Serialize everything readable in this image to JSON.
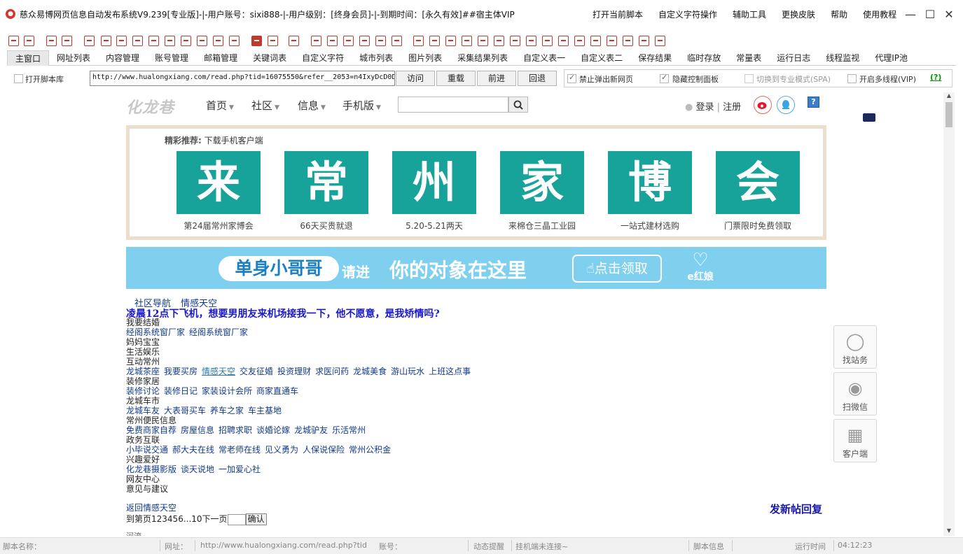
{
  "window": {
    "title": "慈众易博网页信息自动发布系统V9.239[专业版]-|-用户账号：sixi888-|-用户级别：[终身会员]-|-到期时间：[永久有效]##宿主体VIP",
    "menu": [
      "打开当前脚本",
      "自定义字符操作",
      "辅助工具",
      "更换皮肤",
      "帮助",
      "使用教程"
    ]
  },
  "tabs": [
    "主窗口",
    "网址列表",
    "内容管理",
    "账号管理",
    "邮箱管理",
    "关键词表",
    "自定义字符",
    "城市列表",
    "图片列表",
    "采集结果列表",
    "自定义表一",
    "自定义表二",
    "保存结果",
    "临时存放",
    "常量表",
    "运行日志",
    "线程监视",
    "代理IP池"
  ],
  "address_bar": {
    "open_library_label": "打开脚本库",
    "url": "http://www.hualongxiang.com/read.php?tid=16075550&refer__2053=n4IxyDcD0D",
    "buttons": [
      "访问",
      "重载",
      "前进",
      "回退"
    ],
    "options": [
      {
        "label": "禁止弹出新网页",
        "checked": true,
        "disabled": false
      },
      {
        "label": "隐藏控制面板",
        "checked": true,
        "disabled": false
      },
      {
        "label": "切换到专业模式(SPA)",
        "checked": false,
        "disabled": true
      },
      {
        "label": "开启多线程(VIP)",
        "checked": false,
        "disabled": false
      }
    ],
    "help": "(?)"
  },
  "site": {
    "logo": "化龙巷",
    "nav": [
      "首页",
      "社区",
      "信息",
      "手机版"
    ],
    "login": "登录",
    "register": "注册",
    "help_icon": "?",
    "promo": {
      "label": "精彩推荐:",
      "link": "下载手机客户端",
      "tiles": [
        {
          "char": "来",
          "caption": "第24届常州家博会"
        },
        {
          "char": "常",
          "caption": "66天买贵就退"
        },
        {
          "char": "州",
          "caption": "5.20-5.21两天"
        },
        {
          "char": "家",
          "caption": "来棉仓三晶工业园"
        },
        {
          "char": "博",
          "caption": "一站式建材选购"
        },
        {
          "char": "会",
          "caption": "门票限时免费领取"
        }
      ]
    },
    "banner": {
      "pill": "单身小哥哥",
      "t1": "请进",
      "t2": "你的对象在这里",
      "cta": "点击领取",
      "logo": "e红娘"
    },
    "breadcrumb": [
      "社区导航",
      "情感天空"
    ],
    "thread_title": "凌晨12点下飞机，想要男朋友来机场接我一下，他不愿意，是我矫情吗?",
    "forum_rows": [
      {
        "cat": "我要结婚",
        "links": []
      },
      {
        "cat": "",
        "links": [
          "经阁系统窗厂家",
          "经阁系统窗厂家"
        ]
      },
      {
        "cat": "妈妈宝宝",
        "links": []
      },
      {
        "cat": "生活娱乐",
        "links": []
      },
      {
        "cat": "互动常州",
        "links": []
      },
      {
        "cat": "",
        "links": [
          "龙城茶座",
          "我要买房",
          "情感天空",
          "交友征婚",
          "投资理财",
          "求医问药",
          "龙城美食",
          "游山玩水",
          "上班这点事"
        ]
      },
      {
        "cat": "装修家居",
        "links": []
      },
      {
        "cat": "",
        "links": [
          "装修讨论",
          "装修日记",
          "家装设计会所",
          "商家直通车"
        ]
      },
      {
        "cat": "龙城车市",
        "links": []
      },
      {
        "cat": "",
        "links": [
          "龙城车友",
          "大表哥买车",
          "养车之家",
          "车主基地"
        ]
      },
      {
        "cat": "常州便民信息",
        "links": []
      },
      {
        "cat": "",
        "links": [
          "免费商家自荐",
          "房屋信息",
          "招聘求职",
          "谈婚论嫁",
          "龙城驴友",
          "乐活常州"
        ]
      },
      {
        "cat": "政务互联",
        "links": []
      },
      {
        "cat": "",
        "links": [
          "小毕说交通",
          "郝大夫在线",
          "常老师在线",
          "见义勇为",
          "人保说保险",
          "常州公积金"
        ]
      },
      {
        "cat": "兴趣爱好",
        "links": []
      },
      {
        "cat": "",
        "links": [
          "化龙巷摄影版",
          "谈天说地",
          "一加爱心社"
        ]
      },
      {
        "cat": "网友中心",
        "links": []
      },
      {
        "cat": "意见与建议",
        "links": []
      }
    ],
    "back_link": "返回情感天空",
    "pager_prefix": "到第页",
    "pager_pages": "123456...10",
    "pager_next": "下一页",
    "pager_ok": "确认",
    "new_post": "发新帖回复",
    "cutoff_text": "河流",
    "side": [
      {
        "icon": "headset-icon",
        "label": "找站务"
      },
      {
        "icon": "wechat-icon",
        "label": "扫微信"
      },
      {
        "icon": "qrcode-icon",
        "label": "客户端"
      }
    ]
  },
  "status": {
    "script_name_label": "脚本名称：",
    "url_label": "网址：",
    "url_value": "http://www.hualongxiang.com/read.php?tid",
    "account_label": "账号：",
    "dynamic_label": "动态提醒",
    "dynamic_value": "挂机端未连接~",
    "script_info_label": "脚本信息",
    "runtime_label": "运行时间",
    "runtime_value": "04:12:23"
  },
  "colors": {
    "accent_red": "#c0392b",
    "tile_teal": "#17a39a",
    "banner_blue": "#7fd0ef",
    "link_blue": "#123a8a"
  }
}
